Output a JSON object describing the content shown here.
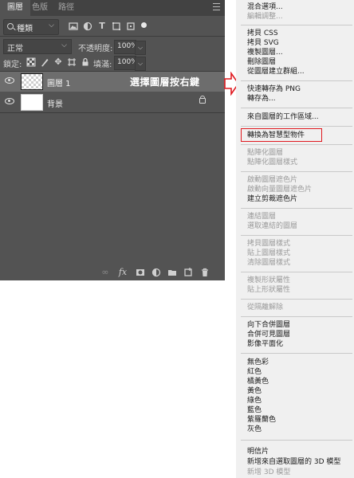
{
  "layers_panel": {
    "tabs": [
      "圖層",
      "色版",
      "路徑"
    ],
    "filter": {
      "kind_label": "種類"
    },
    "blend_mode": "正常",
    "opacity": {
      "label": "不透明度:",
      "value": "100%"
    },
    "lock": {
      "label": "鎖定:"
    },
    "fill": {
      "label": "填滿:",
      "value": "100%"
    },
    "layers": [
      {
        "name": "圖層 1",
        "selected": true,
        "thumbnail": "transparent"
      },
      {
        "name": "背景",
        "selected": false,
        "thumbnail": "white",
        "locked": true
      }
    ],
    "annotation": "選擇圖層按右鍵"
  },
  "context_menu": {
    "items": [
      {
        "label": "混合選項...",
        "enabled": true
      },
      {
        "label": "編輯調整...",
        "enabled": false
      },
      {
        "label": "拷貝 CSS",
        "enabled": true
      },
      {
        "label": "拷貝 SVG",
        "enabled": true
      },
      {
        "label": "複製圖層...",
        "enabled": true
      },
      {
        "label": "刪除圖層",
        "enabled": true
      },
      {
        "label": "從圖層建立群組...",
        "enabled": true
      },
      {
        "label": "快速轉存為 PNG",
        "enabled": true
      },
      {
        "label": "轉存為...",
        "enabled": true
      },
      {
        "label": "來自圖層的工作區域...",
        "enabled": true
      },
      {
        "label": "轉換為智慧型物件",
        "enabled": true,
        "highlighted": true
      },
      {
        "label": "點陣化圖層",
        "enabled": false
      },
      {
        "label": "點陣化圖層樣式",
        "enabled": false
      },
      {
        "label": "啟動圖層遮色片",
        "enabled": false
      },
      {
        "label": "啟動向量圖層遮色片",
        "enabled": false
      },
      {
        "label": "建立剪裁遮色片",
        "enabled": true
      },
      {
        "label": "連結圖層",
        "enabled": false
      },
      {
        "label": "選取連結的圖層",
        "enabled": false
      },
      {
        "label": "拷貝圖層樣式",
        "enabled": false
      },
      {
        "label": "貼上圖層樣式",
        "enabled": false
      },
      {
        "label": "清除圖層樣式",
        "enabled": false
      },
      {
        "label": "複製形狀屬性",
        "enabled": false
      },
      {
        "label": "貼上形狀屬性",
        "enabled": false
      },
      {
        "label": "從隔離解除",
        "enabled": false
      },
      {
        "label": "向下合併圖層",
        "enabled": true
      },
      {
        "label": "合併可見圖層",
        "enabled": true
      },
      {
        "label": "影像平面化",
        "enabled": true
      },
      {
        "label": "無色彩",
        "enabled": true
      },
      {
        "label": "紅色",
        "enabled": true
      },
      {
        "label": "橘黃色",
        "enabled": true
      },
      {
        "label": "黃色",
        "enabled": true
      },
      {
        "label": "綠色",
        "enabled": true
      },
      {
        "label": "藍色",
        "enabled": true
      },
      {
        "label": "紫羅蘭色",
        "enabled": true
      },
      {
        "label": "灰色",
        "enabled": true
      },
      {
        "label": "明信片",
        "enabled": true
      },
      {
        "label": "新增來自選取圖層的 3D 模型",
        "enabled": true
      },
      {
        "label": "新增 3D 模型",
        "enabled": false
      }
    ]
  },
  "colors": {
    "panel_bg": "#535353",
    "selected_layer": "#6d6d6d",
    "highlight_red": "#e0191f",
    "menu_bg": "#f0f0f0"
  }
}
